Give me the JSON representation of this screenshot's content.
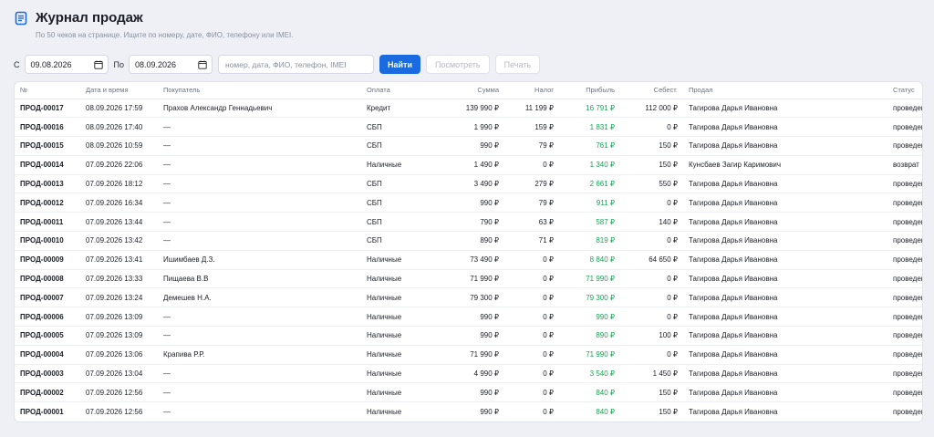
{
  "header": {
    "title": "Журнал продаж",
    "subtitle": "По 50 чеков на странице. Ищите по номеру, дате, ФИО, телефону или IMEI."
  },
  "filters": {
    "from_label": "С",
    "from_value": "09.08.2026",
    "to_label": "По",
    "to_value": "08.09.2026",
    "search_placeholder": "номер, дата, ФИО, телефон, IMEI",
    "search_button": "Найти",
    "view_button": "Посмотреть",
    "print_button": "Печать"
  },
  "table": {
    "columns": [
      "№",
      "Дата и время",
      "Покупатель",
      "Оплата",
      "Сумма",
      "Налог",
      "Прибыль",
      "Себест.",
      "Продал",
      "Статус"
    ],
    "rows": [
      [
        "ПРОД-00017",
        "08.09.2026 17:59",
        "Прахов Александр Геннадьевич",
        "Кредит",
        "139 990 ₽",
        "11 199 ₽",
        "16 791 ₽",
        "112 000 ₽",
        "Тагирова Дарья Ивановна",
        "проведена"
      ],
      [
        "ПРОД-00016",
        "08.09.2026 17:40",
        "—",
        "СБП",
        "1 990 ₽",
        "159 ₽",
        "1 831 ₽",
        "0 ₽",
        "Тагирова Дарья Ивановна",
        "проведена"
      ],
      [
        "ПРОД-00015",
        "08.09.2026 10:59",
        "—",
        "СБП",
        "990 ₽",
        "79 ₽",
        "761 ₽",
        "150 ₽",
        "Тагирова Дарья Ивановна",
        "проведена"
      ],
      [
        "ПРОД-00014",
        "07.09.2026 22:06",
        "—",
        "Наличные",
        "1 490 ₽",
        "0 ₽",
        "1 340 ₽",
        "150 ₽",
        "Кунсбаев Загир Каримович",
        "возврат"
      ],
      [
        "ПРОД-00013",
        "07.09.2026 18:12",
        "—",
        "СБП",
        "3 490 ₽",
        "279 ₽",
        "2 661 ₽",
        "550 ₽",
        "Тагирова Дарья Ивановна",
        "проведена"
      ],
      [
        "ПРОД-00012",
        "07.09.2026 16:34",
        "—",
        "СБП",
        "990 ₽",
        "79 ₽",
        "911 ₽",
        "0 ₽",
        "Тагирова Дарья Ивановна",
        "проведена"
      ],
      [
        "ПРОД-00011",
        "07.09.2026 13:44",
        "—",
        "СБП",
        "790 ₽",
        "63 ₽",
        "587 ₽",
        "140 ₽",
        "Тагирова Дарья Ивановна",
        "проведена"
      ],
      [
        "ПРОД-00010",
        "07.09.2026 13:42",
        "—",
        "СБП",
        "890 ₽",
        "71 ₽",
        "819 ₽",
        "0 ₽",
        "Тагирова Дарья Ивановна",
        "проведена"
      ],
      [
        "ПРОД-00009",
        "07.09.2026 13:41",
        "Ишимбаев Д.З.",
        "Наличные",
        "73 490 ₽",
        "0 ₽",
        "8 840 ₽",
        "64 650 ₽",
        "Тагирова Дарья Ивановна",
        "проведена"
      ],
      [
        "ПРОД-00008",
        "07.09.2026 13:33",
        "Пищаева В.В",
        "Наличные",
        "71 990 ₽",
        "0 ₽",
        "71 990 ₽",
        "0 ₽",
        "Тагирова Дарья Ивановна",
        "проведена"
      ],
      [
        "ПРОД-00007",
        "07.09.2026 13:24",
        "Демешев Н.А.",
        "Наличные",
        "79 300 ₽",
        "0 ₽",
        "79 300 ₽",
        "0 ₽",
        "Тагирова Дарья Ивановна",
        "проведена"
      ],
      [
        "ПРОД-00006",
        "07.09.2026 13:09",
        "—",
        "Наличные",
        "990 ₽",
        "0 ₽",
        "990 ₽",
        "0 ₽",
        "Тагирова Дарья Ивановна",
        "проведена"
      ],
      [
        "ПРОД-00005",
        "07.09.2026 13:09",
        "—",
        "Наличные",
        "990 ₽",
        "0 ₽",
        "890 ₽",
        "100 ₽",
        "Тагирова Дарья Ивановна",
        "проведена"
      ],
      [
        "ПРОД-00004",
        "07.09.2026 13:06",
        "Крапива Р.Р.",
        "Наличные",
        "71 990 ₽",
        "0 ₽",
        "71 990 ₽",
        "0 ₽",
        "Тагирова Дарья Ивановна",
        "проведена"
      ],
      [
        "ПРОД-00003",
        "07.09.2026 13:04",
        "—",
        "Наличные",
        "4 990 ₽",
        "0 ₽",
        "3 540 ₽",
        "1 450 ₽",
        "Тагирова Дарья Ивановна",
        "проведена"
      ],
      [
        "ПРОД-00002",
        "07.09.2026 12:56",
        "—",
        "Наличные",
        "990 ₽",
        "0 ₽",
        "840 ₽",
        "150 ₽",
        "Тагирова Дарья Ивановна",
        "проведена"
      ],
      [
        "ПРОД-00001",
        "07.09.2026 12:56",
        "—",
        "Наличные",
        "990 ₽",
        "0 ₽",
        "840 ₽",
        "150 ₽",
        "Тагирова Дарья Ивановна",
        "проведена"
      ]
    ]
  },
  "colors": {
    "accent": "#1a6ae0",
    "profit": "#1e9e56",
    "background": "#eef0f6"
  },
  "icons": {
    "title": "document-icon",
    "date": "calendar-icon"
  }
}
